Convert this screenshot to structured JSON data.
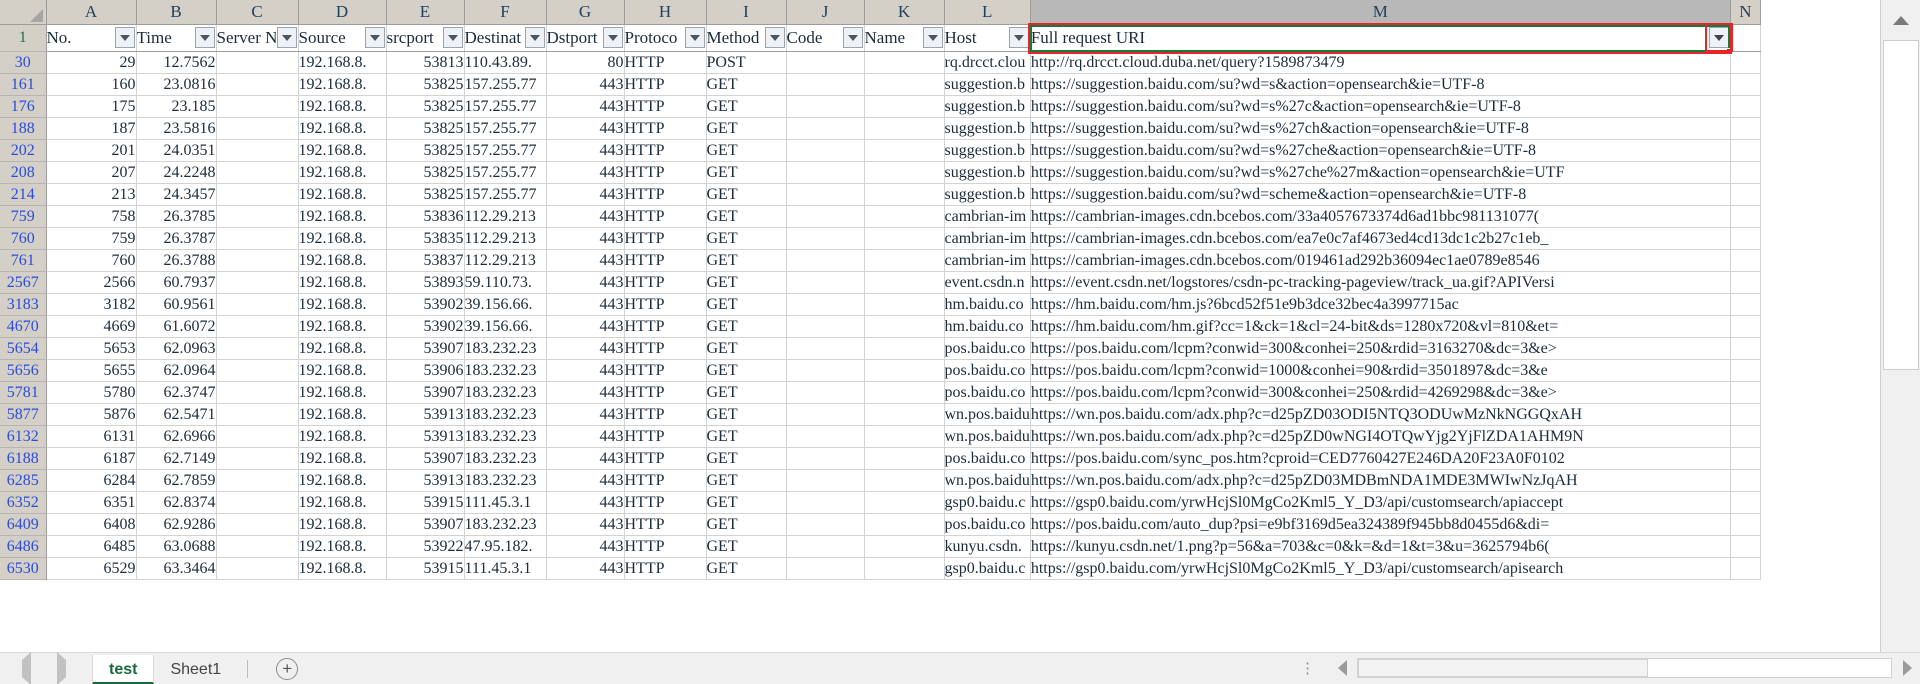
{
  "app": {
    "name": "spreadsheet"
  },
  "grid": {
    "column_letters": [
      "A",
      "B",
      "C",
      "D",
      "E",
      "F",
      "G",
      "H",
      "I",
      "J",
      "K",
      "L",
      "M",
      "N"
    ],
    "selected_column": "M",
    "header_row_number": "1",
    "headers": [
      {
        "label": "No."
      },
      {
        "label": "Time"
      },
      {
        "label": "Server N"
      },
      {
        "label": "Source"
      },
      {
        "label": "srcport"
      },
      {
        "label": "Destinat"
      },
      {
        "label": "Dstport"
      },
      {
        "label": "Protoco"
      },
      {
        "label": "Method"
      },
      {
        "label": "Code"
      },
      {
        "label": "Name"
      },
      {
        "label": "Host"
      },
      {
        "label": "Full request URI"
      }
    ],
    "rows": [
      {
        "n": "30",
        "no": "29",
        "time": "12.7562",
        "server": "",
        "source": "192.168.8.",
        "srcport": "53813",
        "dest": "110.43.89.",
        "dstport": "80",
        "proto": "HTTP",
        "method": "POST",
        "code": "",
        "name": "",
        "host": "rq.drcct.clou",
        "uri": "http://rq.drcct.cloud.duba.net/query?1589873479"
      },
      {
        "n": "161",
        "no": "160",
        "time": "23.0816",
        "server": "",
        "source": "192.168.8.",
        "srcport": "53825",
        "dest": "157.255.77",
        "dstport": "443",
        "proto": "HTTP",
        "method": "GET",
        "code": "",
        "name": "",
        "host": "suggestion.b",
        "uri": "https://suggestion.baidu.com/su?wd=s&action=opensearch&ie=UTF-8"
      },
      {
        "n": "176",
        "no": "175",
        "time": "23.185",
        "server": "",
        "source": "192.168.8.",
        "srcport": "53825",
        "dest": "157.255.77",
        "dstport": "443",
        "proto": "HTTP",
        "method": "GET",
        "code": "",
        "name": "",
        "host": "suggestion.b",
        "uri": "https://suggestion.baidu.com/su?wd=s%27c&action=opensearch&ie=UTF-8"
      },
      {
        "n": "188",
        "no": "187",
        "time": "23.5816",
        "server": "",
        "source": "192.168.8.",
        "srcport": "53825",
        "dest": "157.255.77",
        "dstport": "443",
        "proto": "HTTP",
        "method": "GET",
        "code": "",
        "name": "",
        "host": "suggestion.b",
        "uri": "https://suggestion.baidu.com/su?wd=s%27ch&action=opensearch&ie=UTF-8"
      },
      {
        "n": "202",
        "no": "201",
        "time": "24.0351",
        "server": "",
        "source": "192.168.8.",
        "srcport": "53825",
        "dest": "157.255.77",
        "dstport": "443",
        "proto": "HTTP",
        "method": "GET",
        "code": "",
        "name": "",
        "host": "suggestion.b",
        "uri": "https://suggestion.baidu.com/su?wd=s%27che&action=opensearch&ie=UTF-8"
      },
      {
        "n": "208",
        "no": "207",
        "time": "24.2248",
        "server": "",
        "source": "192.168.8.",
        "srcport": "53825",
        "dest": "157.255.77",
        "dstport": "443",
        "proto": "HTTP",
        "method": "GET",
        "code": "",
        "name": "",
        "host": "suggestion.b",
        "uri": "https://suggestion.baidu.com/su?wd=s%27che%27m&action=opensearch&ie=UTF"
      },
      {
        "n": "214",
        "no": "213",
        "time": "24.3457",
        "server": "",
        "source": "192.168.8.",
        "srcport": "53825",
        "dest": "157.255.77",
        "dstport": "443",
        "proto": "HTTP",
        "method": "GET",
        "code": "",
        "name": "",
        "host": "suggestion.b",
        "uri": "https://suggestion.baidu.com/su?wd=scheme&action=opensearch&ie=UTF-8"
      },
      {
        "n": "759",
        "no": "758",
        "time": "26.3785",
        "server": "",
        "source": "192.168.8.",
        "srcport": "53836",
        "dest": "112.29.213",
        "dstport": "443",
        "proto": "HTTP",
        "method": "GET",
        "code": "",
        "name": "",
        "host": "cambrian-im",
        "uri": "https://cambrian-images.cdn.bcebos.com/33a4057673374d6ad1bbc981131077( "
      },
      {
        "n": "760",
        "no": "759",
        "time": "26.3787",
        "server": "",
        "source": "192.168.8.",
        "srcport": "53835",
        "dest": "112.29.213",
        "dstport": "443",
        "proto": "HTTP",
        "method": "GET",
        "code": "",
        "name": "",
        "host": "cambrian-im",
        "uri": "https://cambrian-images.cdn.bcebos.com/ea7e0c7af4673ed4cd13dc1c2b27c1eb_"
      },
      {
        "n": "761",
        "no": "760",
        "time": "26.3788",
        "server": "",
        "source": "192.168.8.",
        "srcport": "53837",
        "dest": "112.29.213",
        "dstport": "443",
        "proto": "HTTP",
        "method": "GET",
        "code": "",
        "name": "",
        "host": "cambrian-im",
        "uri": "https://cambrian-images.cdn.bcebos.com/019461ad292b36094ec1ae0789e8546"
      },
      {
        "n": "2567",
        "no": "2566",
        "time": "60.7937",
        "server": "",
        "source": "192.168.8.",
        "srcport": "53893",
        "dest": "59.110.73.",
        "dstport": "443",
        "proto": "HTTP",
        "method": "GET",
        "code": "",
        "name": "",
        "host": "event.csdn.n",
        "uri": "https://event.csdn.net/logstores/csdn-pc-tracking-pageview/track_ua.gif?APIVersi"
      },
      {
        "n": "3183",
        "no": "3182",
        "time": "60.9561",
        "server": "",
        "source": "192.168.8.",
        "srcport": "53902",
        "dest": "39.156.66.",
        "dstport": "443",
        "proto": "HTTP",
        "method": "GET",
        "code": "",
        "name": "",
        "host": "hm.baidu.co",
        "uri": "https://hm.baidu.com/hm.js?6bcd52f51e9b3dce32bec4a3997715ac"
      },
      {
        "n": "4670",
        "no": "4669",
        "time": "61.6072",
        "server": "",
        "source": "192.168.8.",
        "srcport": "53902",
        "dest": "39.156.66.",
        "dstport": "443",
        "proto": "HTTP",
        "method": "GET",
        "code": "",
        "name": "",
        "host": "hm.baidu.co",
        "uri": "https://hm.baidu.com/hm.gif?cc=1&ck=1&cl=24-bit&ds=1280x720&vl=810&et="
      },
      {
        "n": "5654",
        "no": "5653",
        "time": "62.0963",
        "server": "",
        "source": "192.168.8.",
        "srcport": "53907",
        "dest": "183.232.23",
        "dstport": "443",
        "proto": "HTTP",
        "method": "GET",
        "code": "",
        "name": "",
        "host": "pos.baidu.co",
        "uri": "https://pos.baidu.com/lcpm?conwid=300&conhei=250&rdid=3163270&dc=3&e>"
      },
      {
        "n": "5656",
        "no": "5655",
        "time": "62.0964",
        "server": "",
        "source": "192.168.8.",
        "srcport": "53906",
        "dest": "183.232.23",
        "dstport": "443",
        "proto": "HTTP",
        "method": "GET",
        "code": "",
        "name": "",
        "host": "pos.baidu.co",
        "uri": "https://pos.baidu.com/lcpm?conwid=1000&conhei=90&rdid=3501897&dc=3&e"
      },
      {
        "n": "5781",
        "no": "5780",
        "time": "62.3747",
        "server": "",
        "source": "192.168.8.",
        "srcport": "53907",
        "dest": "183.232.23",
        "dstport": "443",
        "proto": "HTTP",
        "method": "GET",
        "code": "",
        "name": "",
        "host": "pos.baidu.co",
        "uri": "https://pos.baidu.com/lcpm?conwid=300&conhei=250&rdid=4269298&dc=3&e>"
      },
      {
        "n": "5877",
        "no": "5876",
        "time": "62.5471",
        "server": "",
        "source": "192.168.8.",
        "srcport": "53913",
        "dest": "183.232.23",
        "dstport": "443",
        "proto": "HTTP",
        "method": "GET",
        "code": "",
        "name": "",
        "host": "wn.pos.baidu",
        "uri": "https://wn.pos.baidu.com/adx.php?c=d25pZD03ODI5NTQ3ODUwMzNkNGGQxAH"
      },
      {
        "n": "6132",
        "no": "6131",
        "time": "62.6966",
        "server": "",
        "source": "192.168.8.",
        "srcport": "53913",
        "dest": "183.232.23",
        "dstport": "443",
        "proto": "HTTP",
        "method": "GET",
        "code": "",
        "name": "",
        "host": "wn.pos.baidu",
        "uri": "https://wn.pos.baidu.com/adx.php?c=d25pZD0wNGI4OTQwYjg2YjFlZDA1AHM9N"
      },
      {
        "n": "6188",
        "no": "6187",
        "time": "62.7149",
        "server": "",
        "source": "192.168.8.",
        "srcport": "53907",
        "dest": "183.232.23",
        "dstport": "443",
        "proto": "HTTP",
        "method": "GET",
        "code": "",
        "name": "",
        "host": "pos.baidu.co",
        "uri": "https://pos.baidu.com/sync_pos.htm?cproid=CED7760427E246DA20F23A0F0102"
      },
      {
        "n": "6285",
        "no": "6284",
        "time": "62.7859",
        "server": "",
        "source": "192.168.8.",
        "srcport": "53913",
        "dest": "183.232.23",
        "dstport": "443",
        "proto": "HTTP",
        "method": "GET",
        "code": "",
        "name": "",
        "host": "wn.pos.baidu",
        "uri": "https://wn.pos.baidu.com/adx.php?c=d25pZD03MDBmNDA1MDE3MWIwNzJqAH"
      },
      {
        "n": "6352",
        "no": "6351",
        "time": "62.8374",
        "server": "",
        "source": "192.168.8.",
        "srcport": "53915",
        "dest": "111.45.3.1",
        "dstport": "443",
        "proto": "HTTP",
        "method": "GET",
        "code": "",
        "name": "",
        "host": "gsp0.baidu.c",
        "uri": "https://gsp0.baidu.com/yrwHcjSl0MgCo2Kml5_Y_D3/api/customsearch/apiaccept"
      },
      {
        "n": "6409",
        "no": "6408",
        "time": "62.9286",
        "server": "",
        "source": "192.168.8.",
        "srcport": "53907",
        "dest": "183.232.23",
        "dstport": "443",
        "proto": "HTTP",
        "method": "GET",
        "code": "",
        "name": "",
        "host": "pos.baidu.co",
        "uri": "https://pos.baidu.com/auto_dup?psi=e9bf3169d5ea324389f945bb8d0455d6&di="
      },
      {
        "n": "6486",
        "no": "6485",
        "time": "63.0688",
        "server": "",
        "source": "192.168.8.",
        "srcport": "53922",
        "dest": "47.95.182.",
        "dstport": "443",
        "proto": "HTTP",
        "method": "GET",
        "code": "",
        "name": "",
        "host": "kunyu.csdn.",
        "uri": "https://kunyu.csdn.net/1.png?p=56&a=703&c=0&k=&d=1&t=3&u=3625794b6("
      },
      {
        "n": "6530",
        "no": "6529",
        "time": "63.3464",
        "server": "",
        "source": "192.168.8.",
        "srcport": "53915",
        "dest": "111.45.3.1",
        "dstport": "443",
        "proto": "HTTP",
        "method": "GET",
        "code": "",
        "name": "",
        "host": "gsp0.baidu.c",
        "uri": "https://gsp0.baidu.com/yrwHcjSl0MgCo2Kml5_Y_D3/api/customsearch/apisearch"
      }
    ]
  },
  "sheet_tabs": {
    "tabs": [
      {
        "label": "test",
        "active": true
      },
      {
        "label": "Sheet1",
        "active": false
      }
    ],
    "add_label": "+"
  },
  "icons": {
    "select_all": "select-all-triangle",
    "filter_arrow": "chevron-down-icon",
    "scroll_up": "caret-up-icon",
    "scroll_down": "caret-down-icon",
    "prev_sheet": "caret-left-icon",
    "next_sheet": "caret-right-icon",
    "overflow_dots": "⋮"
  },
  "colors": {
    "selection_green": "#147a3d",
    "annotation_red": "#e8232a",
    "header_gray": "#d4d0c8",
    "filtered_row_blue": "#2a4cd7",
    "active_tab_green": "#186b3e"
  }
}
